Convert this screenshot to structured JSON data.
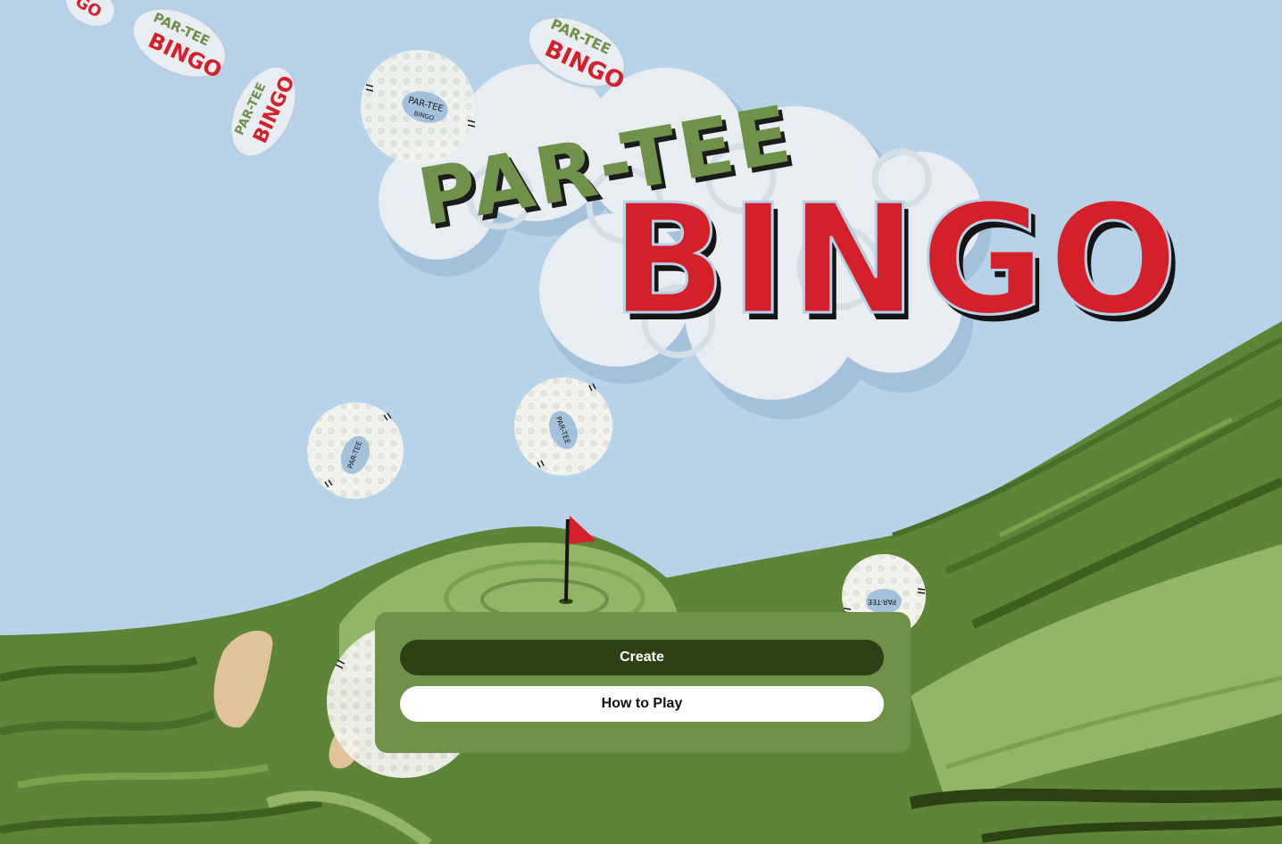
{
  "logo": {
    "line1": "PAR-TEE",
    "line2": "BINGO",
    "sticker_small_top": "PAR-TEE",
    "sticker_small_bottom": "BINGO",
    "ball_label_top": "PAR-TEE",
    "ball_label_bottom": "BINGO"
  },
  "menu": {
    "create_label": "Create",
    "how_to_play_label": "How to Play"
  },
  "colors": {
    "sky": "#b7d3ea",
    "panel": "#6f9149",
    "create_button": "#2c4215",
    "how_to_play_button": "#ffffff",
    "flag": "#d4202a",
    "bingo_red": "#d4202a",
    "partee_green": "#6f9149"
  },
  "icons": [
    "golf-flag-icon",
    "golf-ball-icon",
    "cloud-logo"
  ]
}
